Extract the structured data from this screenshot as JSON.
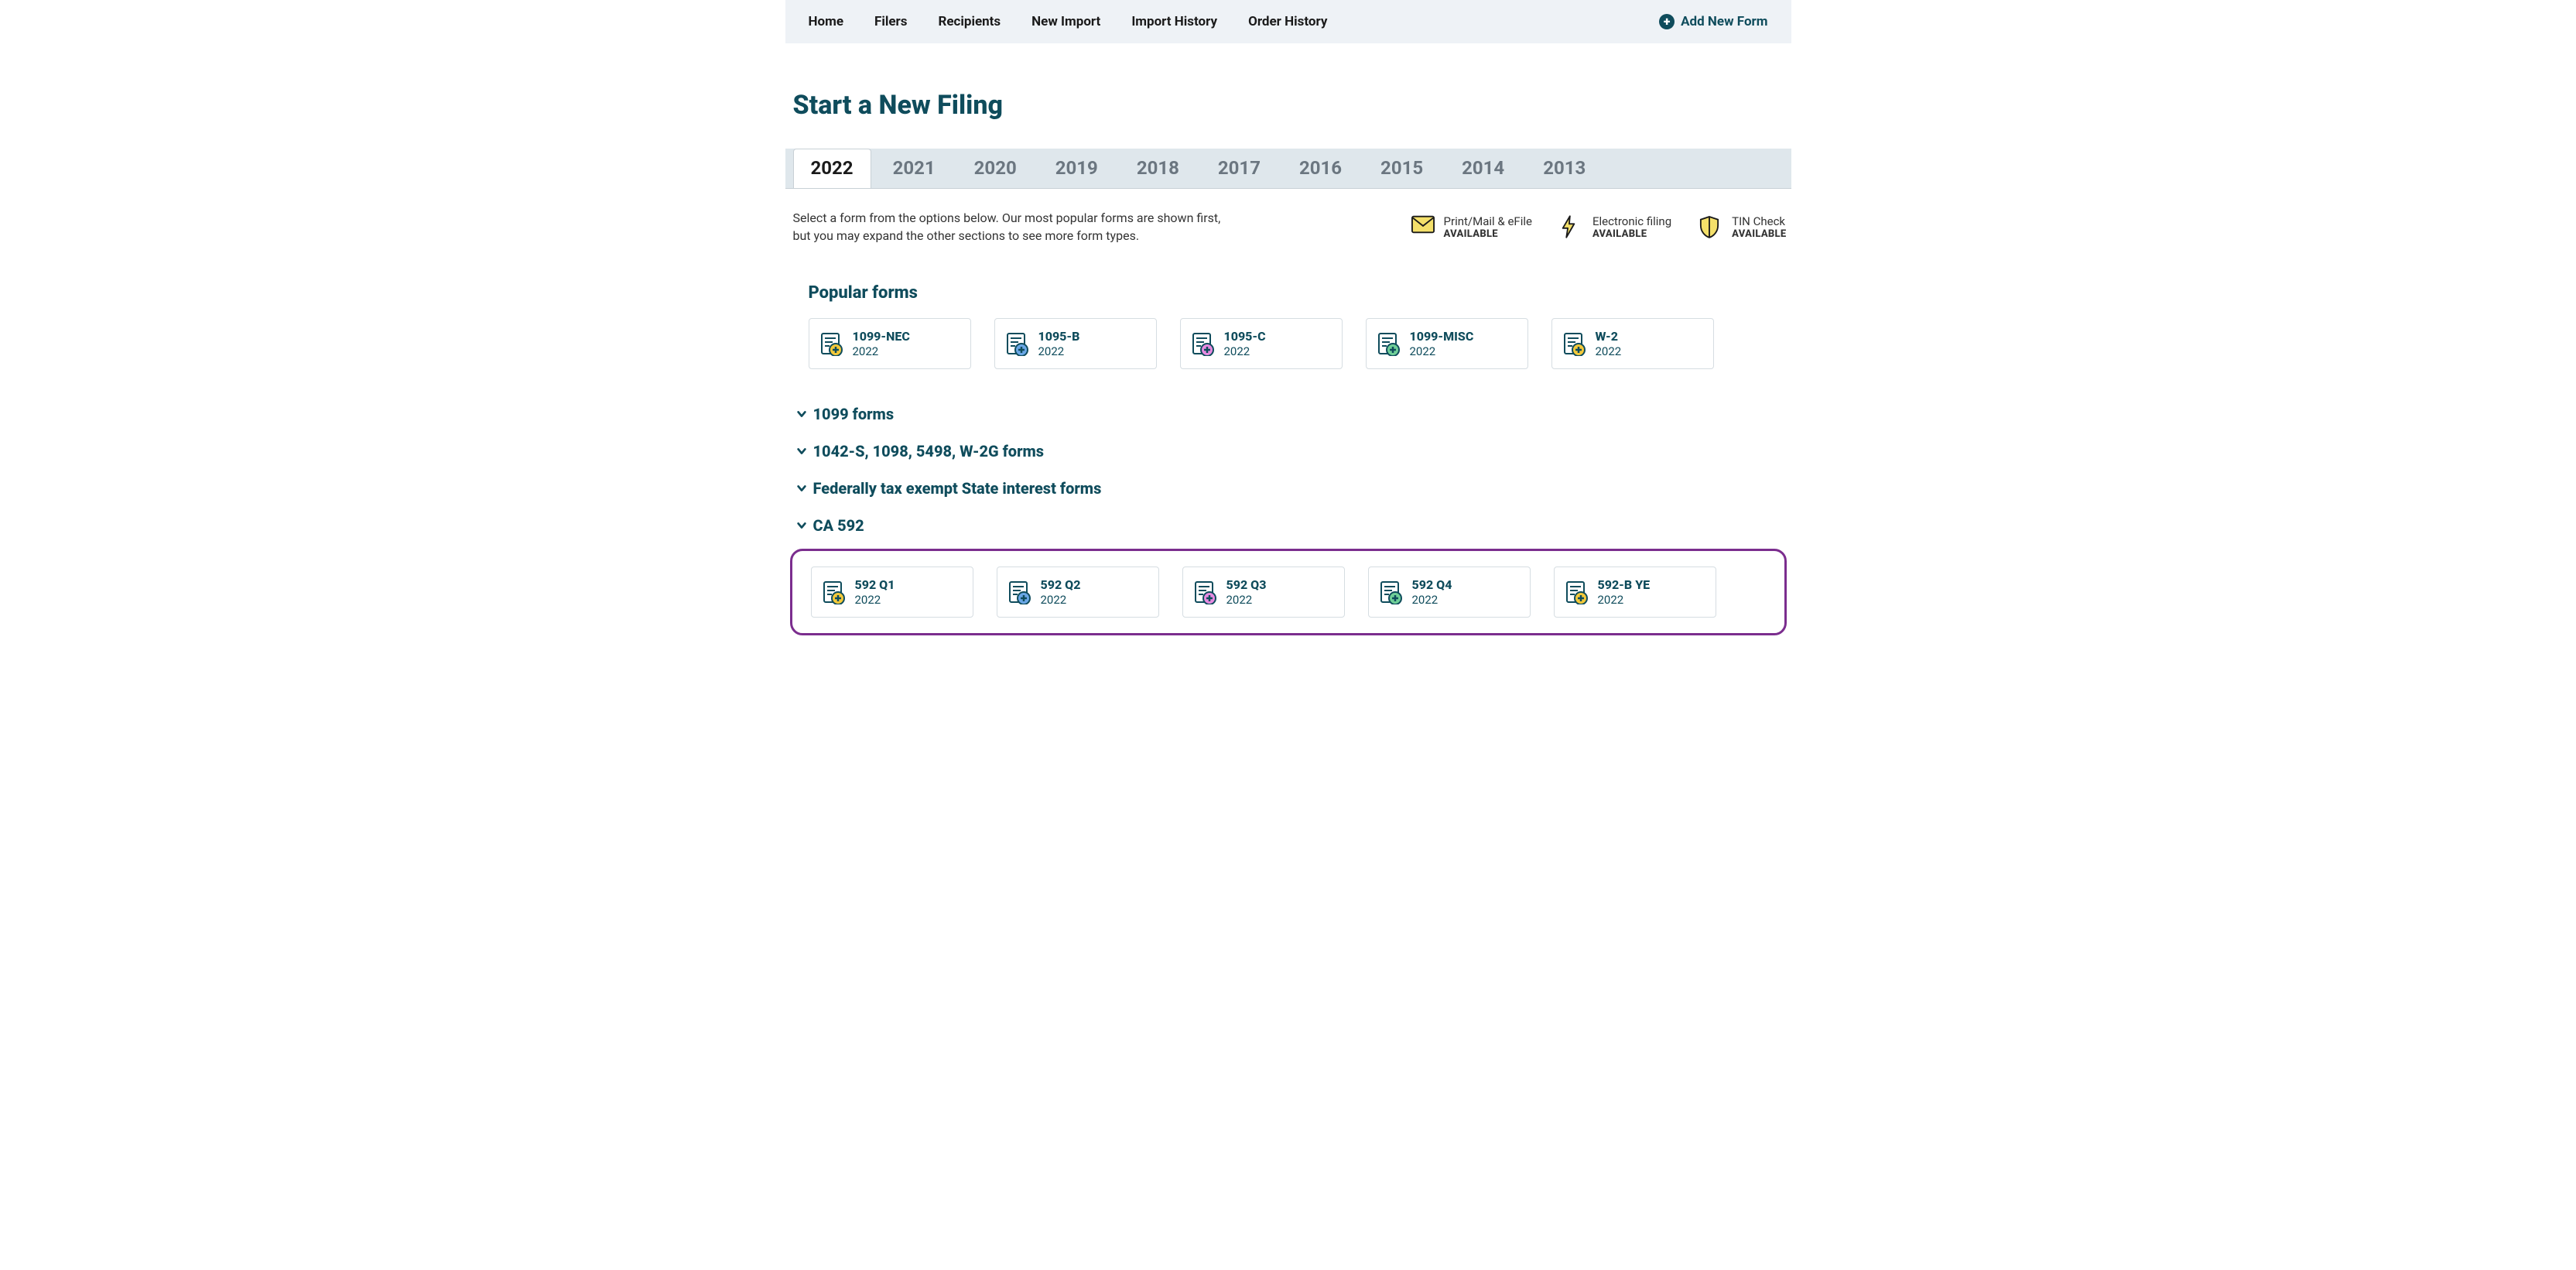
{
  "nav": {
    "items": [
      "Home",
      "Filers",
      "Recipients",
      "New Import",
      "Import History",
      "Order History"
    ],
    "add_new_form": "Add New Form"
  },
  "page_title": "Start a New Filing",
  "years": [
    "2022",
    "2021",
    "2020",
    "2019",
    "2018",
    "2017",
    "2016",
    "2015",
    "2014",
    "2013"
  ],
  "active_year_index": 0,
  "subtext_line1": "Select a form from the options below. Our most popular forms are shown first,",
  "subtext_line2": "but you may expand the other sections to see more form types.",
  "legend": [
    {
      "label": "Print/Mail & eFile",
      "status": "AVAILABLE",
      "icon": "envelope-icon"
    },
    {
      "label": "Electronic filing",
      "status": "AVAILABLE",
      "icon": "lightning-icon"
    },
    {
      "label": "TIN Check",
      "status": "AVAILABLE",
      "icon": "shield-icon"
    }
  ],
  "popular": {
    "title": "Popular forms",
    "forms": [
      {
        "name": "1099-NEC",
        "year": "2022",
        "accent": "#f4c93a"
      },
      {
        "name": "1095-B",
        "year": "2022",
        "accent": "#6aa7e6"
      },
      {
        "name": "1095-C",
        "year": "2022",
        "accent": "#e68be0"
      },
      {
        "name": "1099-MISC",
        "year": "2022",
        "accent": "#6fcf97"
      },
      {
        "name": "W-2",
        "year": "2022",
        "accent": "#f4c93a"
      }
    ]
  },
  "categories": [
    "1099 forms",
    "1042-S, 1098, 5498, W-2G forms",
    "Federally tax exempt State interest forms",
    "CA 592"
  ],
  "ca592_forms": [
    {
      "name": "592 Q1",
      "year": "2022",
      "accent": "#f4c93a"
    },
    {
      "name": "592 Q2",
      "year": "2022",
      "accent": "#6aa7e6"
    },
    {
      "name": "592 Q3",
      "year": "2022",
      "accent": "#e68be0"
    },
    {
      "name": "592 Q4",
      "year": "2022",
      "accent": "#6fcf97"
    },
    {
      "name": "592-B YE",
      "year": "2022",
      "accent": "#f4c93a"
    }
  ]
}
